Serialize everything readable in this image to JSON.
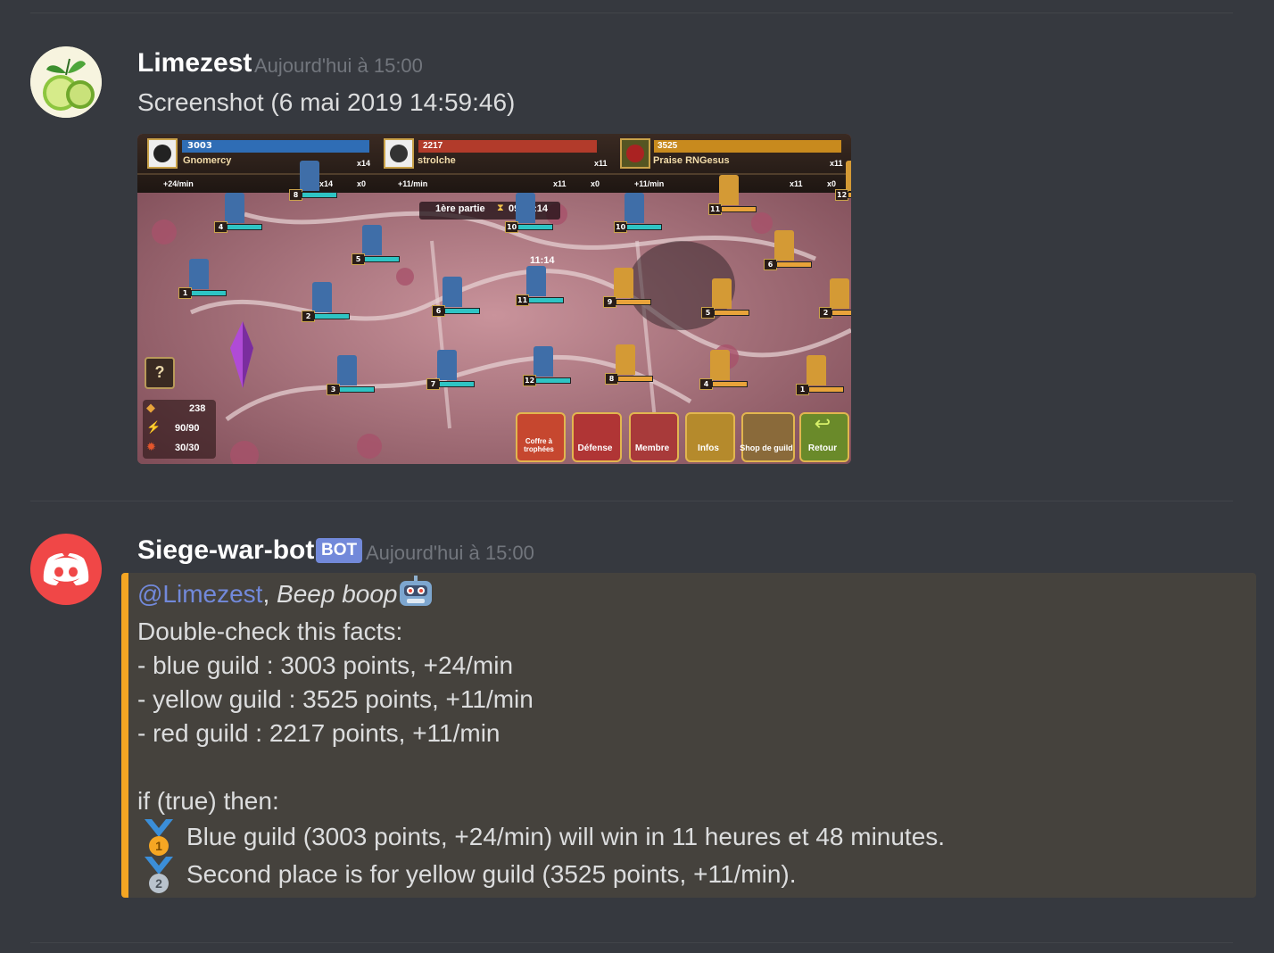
{
  "message1": {
    "username": "Limezest",
    "timestamp": "Aujourd'hui à 15:00",
    "text": "Screenshot (6 mai 2019 14:59:46)"
  },
  "game": {
    "guilds": [
      {
        "score": "3003",
        "name": "Gnomercy",
        "rate": "+24/min",
        "count_top": "x14",
        "count_a": "x14",
        "count_b": "x0"
      },
      {
        "score": "2217",
        "name": "strolche",
        "rate": "+11/min",
        "count_top": "x11",
        "count_a": "x11",
        "count_b": "x0"
      },
      {
        "score": "3525",
        "name": "Praise RNGesus",
        "rate": "+11/min",
        "count_top": "x11",
        "count_a": "x11",
        "count_b": "x0"
      }
    ],
    "phase": "1ère partie",
    "timer": "09:00:14",
    "center_label": "11:14",
    "side_stats": [
      "238",
      "90/90",
      "30/30"
    ],
    "help": "?",
    "buttons": [
      "Coffre à trophées",
      "Défense",
      "Membre",
      "Infos",
      "Shop de guild",
      "Retour"
    ],
    "tower_numbers": [
      "8",
      "4",
      "5",
      "1",
      "2",
      "3",
      "6",
      "7",
      "10",
      "11",
      "12",
      "10",
      "11",
      "6",
      "9",
      "5",
      "2",
      "8",
      "4",
      "1",
      "12"
    ]
  },
  "message2": {
    "username": "Siege-war-bot",
    "bot_tag": "BOT",
    "timestamp": "Aujourd'hui à 15:00",
    "mention": "@Limezest",
    "greeting": "Beep boop",
    "lines": [
      "Double-check this facts:",
      "- blue guild : 3003 points, +24/min",
      "- yellow guild : 3525 points, +11/min",
      "- red guild : 2217 points, +11/min",
      "if (true) then:"
    ],
    "results": [
      {
        "medal": "1",
        "text": "Blue guild (3003 points, +24/min) will win in 11 heures et 48 minutes."
      },
      {
        "medal": "2",
        "text": "Second place is for yellow guild (3525 points, +11/min)."
      }
    ]
  },
  "colors": {
    "accent": "#f5a623",
    "blurple": "#7289da",
    "background": "#36393f"
  }
}
